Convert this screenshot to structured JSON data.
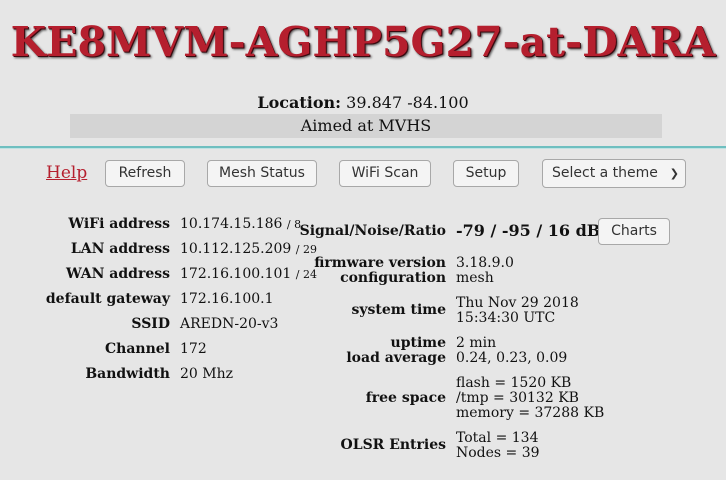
{
  "header": {
    "node_name": "KE8MVM-AGHP5G27-at-DARA",
    "location_label": "Location:",
    "location_value": "39.847 -84.100",
    "description": "Aimed at MVHS"
  },
  "toolbar": {
    "help_label": "Help",
    "refresh_label": "Refresh",
    "mesh_status_label": "Mesh Status",
    "wifi_scan_label": "WiFi Scan",
    "setup_label": "Setup",
    "theme_select_value": "Select a theme"
  },
  "left_info": {
    "wifi_address_label": "WiFi address",
    "wifi_address_value": "10.174.15.186",
    "wifi_mask": "/ 8",
    "lan_address_label": "LAN address",
    "lan_address_value": "10.112.125.209",
    "lan_mask": "/ 29",
    "wan_address_label": "WAN address",
    "wan_address_value": "172.16.100.101",
    "wan_mask": "/ 24",
    "gateway_label": "default gateway",
    "gateway_value": "172.16.100.1",
    "ssid_label": "SSID",
    "ssid_value": "AREDN-20-v3",
    "channel_label": "Channel",
    "channel_value": "172",
    "bandwidth_label": "Bandwidth",
    "bandwidth_value": "20 Mhz"
  },
  "right_info": {
    "snr_label": "Signal/Noise/Ratio",
    "snr_value": "-79 / -95 / 16 dB",
    "charts_label": "Charts",
    "firmware_label": "firmware version",
    "firmware_value": "3.18.9.0",
    "configuration_label": "configuration",
    "configuration_value": "mesh",
    "system_time_label": "system time",
    "system_date": "Thu Nov 29 2018",
    "system_clock": "15:34:30 UTC",
    "uptime_label": "uptime",
    "uptime_value": "2 min",
    "load_label": "load average",
    "load_value": "0.24, 0.23, 0.09",
    "free_space_label": "free space",
    "flash_value": "flash = 1520 KB",
    "tmp_value": "/tmp = 30132 KB",
    "memory_value": "memory = 37288 KB",
    "olsr_label": "OLSR Entries",
    "olsr_total": "Total = 134",
    "olsr_nodes": "Nodes = 39"
  },
  "colors": {
    "title": "#b51f2e",
    "divider": "#6fbfc0",
    "background": "#e6e6e6"
  }
}
